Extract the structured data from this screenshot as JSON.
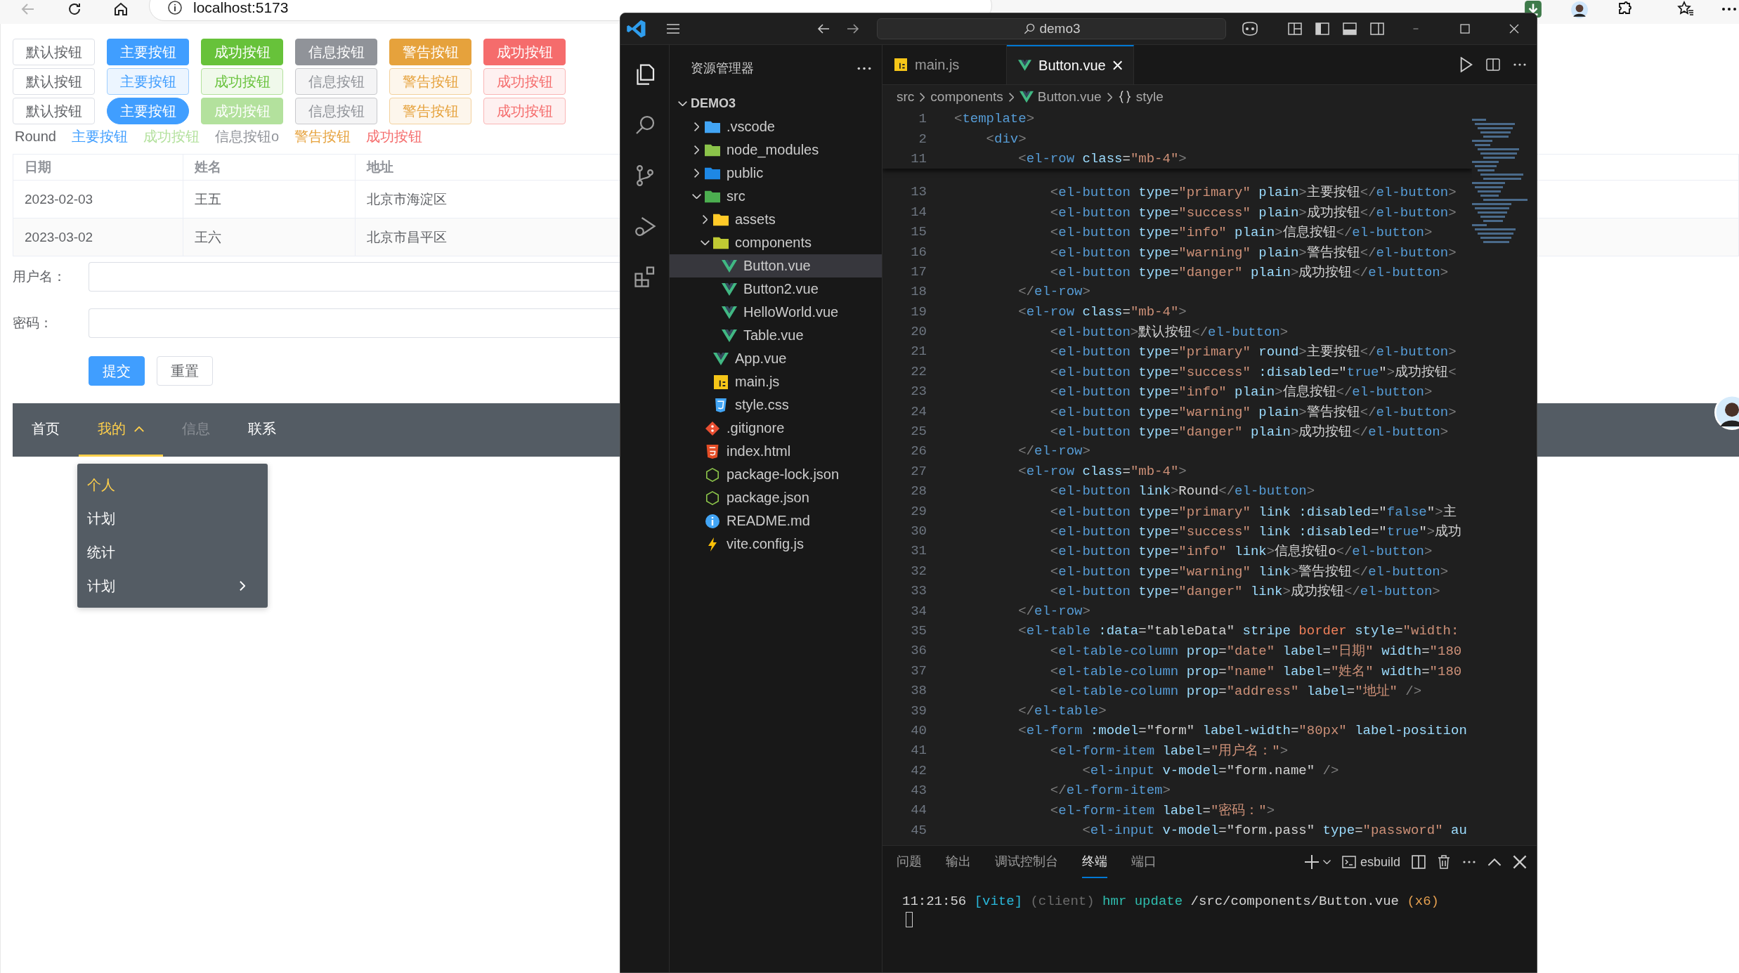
{
  "browser": {
    "address": "localhost:5173",
    "button_rows": [
      {
        "buttons": [
          {
            "label": "默认按钮",
            "kind": "default",
            "plain": false,
            "round": false,
            "disabled": false
          },
          {
            "label": "主要按钮",
            "kind": "primary",
            "plain": false,
            "round": false,
            "disabled": false
          },
          {
            "label": "成功按钮",
            "kind": "success",
            "plain": false,
            "round": false,
            "disabled": false
          },
          {
            "label": "信息按钮",
            "kind": "info",
            "plain": false,
            "round": false,
            "disabled": false
          },
          {
            "label": "警告按钮",
            "kind": "warning",
            "plain": false,
            "round": false,
            "disabled": false
          },
          {
            "label": "成功按钮",
            "kind": "danger",
            "plain": false,
            "round": false,
            "disabled": false
          }
        ]
      },
      {
        "buttons": [
          {
            "label": "默认按钮",
            "kind": "default",
            "plain": false,
            "round": false,
            "disabled": false
          },
          {
            "label": "主要按钮",
            "kind": "primary",
            "plain": true,
            "round": false,
            "disabled": false
          },
          {
            "label": "成功按钮",
            "kind": "success",
            "plain": true,
            "round": false,
            "disabled": false
          },
          {
            "label": "信息按钮",
            "kind": "info",
            "plain": true,
            "round": false,
            "disabled": false
          },
          {
            "label": "警告按钮",
            "kind": "warning",
            "plain": true,
            "round": false,
            "disabled": false
          },
          {
            "label": "成功按钮",
            "kind": "danger",
            "plain": true,
            "round": false,
            "disabled": false
          }
        ]
      },
      {
        "buttons": [
          {
            "label": "默认按钮",
            "kind": "default",
            "plain": false,
            "round": false,
            "disabled": false
          },
          {
            "label": "主要按钮",
            "kind": "primary",
            "plain": false,
            "round": true,
            "disabled": false
          },
          {
            "label": "成功按钮",
            "kind": "success",
            "plain": false,
            "round": false,
            "disabled": true
          },
          {
            "label": "信息按钮",
            "kind": "info",
            "plain": true,
            "round": false,
            "disabled": false
          },
          {
            "label": "警告按钮",
            "kind": "warning",
            "plain": true,
            "round": false,
            "disabled": false
          },
          {
            "label": "成功按钮",
            "kind": "danger",
            "plain": true,
            "round": false,
            "disabled": false
          }
        ]
      }
    ],
    "link_buttons": [
      {
        "label": "Round",
        "kind": "default",
        "disabled": false
      },
      {
        "label": "主要按钮",
        "kind": "primary",
        "disabled": false
      },
      {
        "label": "成功按钮",
        "kind": "success",
        "disabled": true
      },
      {
        "label": "信息按钮o",
        "kind": "info",
        "disabled": false
      },
      {
        "label": "警告按钮",
        "kind": "warning",
        "disabled": false
      },
      {
        "label": "成功按钮",
        "kind": "danger",
        "disabled": false
      }
    ],
    "table": {
      "columns": [
        "日期",
        "姓名",
        "地址"
      ],
      "rows": [
        [
          "2023-02-03",
          "王五",
          "北京市海淀区"
        ],
        [
          "2023-03-02",
          "王六",
          "北京市昌平区"
        ]
      ]
    },
    "form": {
      "fields": [
        {
          "label": "用户名："
        },
        {
          "label": "密码："
        }
      ],
      "buttons": [
        {
          "label": "提交",
          "kind": "primary"
        },
        {
          "label": "重置",
          "kind": "default"
        }
      ]
    },
    "menu": {
      "items": [
        {
          "label": "首页",
          "selected": false,
          "disabled": false
        },
        {
          "label": "我的",
          "selected": true,
          "disabled": false,
          "expanded": true
        },
        {
          "label": "信息",
          "selected": false,
          "disabled": true
        },
        {
          "label": "联系",
          "selected": false,
          "disabled": false
        }
      ]
    },
    "submenu": {
      "items": [
        {
          "label": "个人",
          "selected": true
        },
        {
          "label": "计划",
          "selected": false
        },
        {
          "label": "统计",
          "selected": false
        },
        {
          "label": "计划",
          "selected": false,
          "expanded": false
        }
      ]
    }
  },
  "vscode": {
    "search": "demo3",
    "explorer": {
      "title": "资源管理器",
      "root": "DEMO3",
      "root_expanded": true,
      "tree": [
        {
          "name": ".vscode",
          "kind": "folder",
          "color": "#42a5f5",
          "expanded": false,
          "selected": false
        },
        {
          "name": "node_modules",
          "kind": "folder",
          "color": "#8bc34a",
          "expanded": false,
          "selected": false
        },
        {
          "name": "public",
          "kind": "folder",
          "color": "#1e88e5",
          "expanded": false,
          "selected": false
        },
        {
          "name": "src",
          "kind": "folder",
          "color": "#4caf50",
          "expanded": true,
          "selected": false,
          "children": [
            {
              "name": "assets",
              "kind": "folder",
              "color": "#ffca28",
              "expanded": false,
              "selected": false
            },
            {
              "name": "components",
              "kind": "folder",
              "color": "#c0ca33",
              "expanded": true,
              "selected": false,
              "children": [
                {
                  "name": "Button.vue",
                  "kind": "vue",
                  "selected": true
                },
                {
                  "name": "Button2.vue",
                  "kind": "vue",
                  "selected": false
                },
                {
                  "name": "HelloWorld.vue",
                  "kind": "vue",
                  "selected": false
                },
                {
                  "name": "Table.vue",
                  "kind": "vue",
                  "selected": false
                }
              ]
            },
            {
              "name": "App.vue",
              "kind": "vue",
              "selected": false
            },
            {
              "name": "main.js",
              "kind": "js",
              "selected": false
            },
            {
              "name": "style.css",
              "kind": "css",
              "selected": false
            }
          ]
        },
        {
          "name": ".gitignore",
          "kind": "git",
          "selected": false
        },
        {
          "name": "index.html",
          "kind": "html",
          "selected": false
        },
        {
          "name": "package-lock.json",
          "kind": "json",
          "selected": false
        },
        {
          "name": "package.json",
          "kind": "json",
          "selected": false
        },
        {
          "name": "README.md",
          "kind": "readme",
          "selected": false
        },
        {
          "name": "vite.config.js",
          "kind": "vite",
          "selected": false
        }
      ]
    },
    "tabs": [
      {
        "label": "main.js",
        "kind": "js",
        "selected": false
      },
      {
        "label": "Button.vue",
        "kind": "vue",
        "selected": true
      }
    ],
    "breadcrumbs": [
      {
        "label": "src",
        "kind": "folder"
      },
      {
        "label": "components",
        "kind": "folder"
      },
      {
        "label": "Button.vue",
        "kind": "vue"
      },
      {
        "label": "style",
        "kind": "symbol"
      }
    ],
    "sticky_lines": [
      {
        "number": "1",
        "text": "<template>"
      },
      {
        "number": "2",
        "text": "    <div>"
      },
      {
        "number": "11",
        "text": "        <el-row class=\"mb-4\">"
      }
    ],
    "lines": [
      {
        "number": "13",
        "text": "            <el-button type=\"primary\" plain>主要按钮</el-button>"
      },
      {
        "number": "14",
        "text": "            <el-button type=\"success\" plain>成功按钮</el-button>"
      },
      {
        "number": "15",
        "text": "            <el-button type=\"info\" plain>信息按钮</el-button>"
      },
      {
        "number": "16",
        "text": "            <el-button type=\"warning\" plain>警告按钮</el-button>"
      },
      {
        "number": "17",
        "text": "            <el-button type=\"danger\" plain>成功按钮</el-button>"
      },
      {
        "number": "18",
        "text": "        </el-row>"
      },
      {
        "number": "19",
        "text": "        <el-row class=\"mb-4\">"
      },
      {
        "number": "20",
        "text": "            <el-button>默认按钮</el-button>"
      },
      {
        "number": "21",
        "text": "            <el-button type=\"primary\" round>主要按钮</el-button>"
      },
      {
        "number": "22",
        "text": "            <el-button type=\"success\" :disabled=\"true\">成功按钮<"
      },
      {
        "number": "23",
        "text": "            <el-button type=\"info\" plain>信息按钮</el-button>"
      },
      {
        "number": "24",
        "text": "            <el-button type=\"warning\" plain>警告按钮</el-button>"
      },
      {
        "number": "25",
        "text": "            <el-button type=\"danger\" plain>成功按钮</el-button>"
      },
      {
        "number": "26",
        "text": "        </el-row>"
      },
      {
        "number": "27",
        "text": "        <el-row class=\"mb-4\">"
      },
      {
        "number": "28",
        "text": "            <el-button link>Round</el-button>"
      },
      {
        "number": "29",
        "text": "            <el-button type=\"primary\" link :disabled=\"false\">主"
      },
      {
        "number": "30",
        "text": "            <el-button type=\"success\" link :disabled=\"true\">成功"
      },
      {
        "number": "31",
        "text": "            <el-button type=\"info\" link>信息按钮o</el-button>"
      },
      {
        "number": "32",
        "text": "            <el-button type=\"warning\" link>警告按钮</el-button>"
      },
      {
        "number": "33",
        "text": "            <el-button type=\"danger\" link>成功按钮</el-button>"
      },
      {
        "number": "34",
        "text": "        </el-row>"
      },
      {
        "number": "35",
        "text": "        <el-table :data=\"tableData\" stripe border style=\"width:"
      },
      {
        "number": "36",
        "text": "            <el-table-column prop=\"date\" label=\"日期\" width=\"180"
      },
      {
        "number": "37",
        "text": "            <el-table-column prop=\"name\" label=\"姓名\" width=\"180"
      },
      {
        "number": "38",
        "text": "            <el-table-column prop=\"address\" label=\"地址\" />"
      },
      {
        "number": "39",
        "text": "        </el-table>"
      },
      {
        "number": "40",
        "text": "        <el-form :model=\"form\" label-width=\"80px\" label-position"
      },
      {
        "number": "41",
        "text": "            <el-form-item label=\"用户名：\">"
      },
      {
        "number": "42",
        "text": "                <el-input v-model=\"form.name\" />"
      },
      {
        "number": "43",
        "text": "            </el-form-item>"
      },
      {
        "number": "44",
        "text": "            <el-form-item label=\"密码：\">"
      },
      {
        "number": "45",
        "text": "                <el-input v-model=\"form.pass\" type=\"password\" au"
      }
    ],
    "panel": {
      "tabs": [
        {
          "label": "问题",
          "selected": false
        },
        {
          "label": "输出",
          "selected": false
        },
        {
          "label": "调试控制台",
          "selected": false
        },
        {
          "label": "终端",
          "selected": true
        },
        {
          "label": "端口",
          "selected": false
        }
      ],
      "terminal_name": "esbuild",
      "output": "11:21:56 [vite] (client) hmr update /src/components/Button.vue (x6)"
    }
  }
}
